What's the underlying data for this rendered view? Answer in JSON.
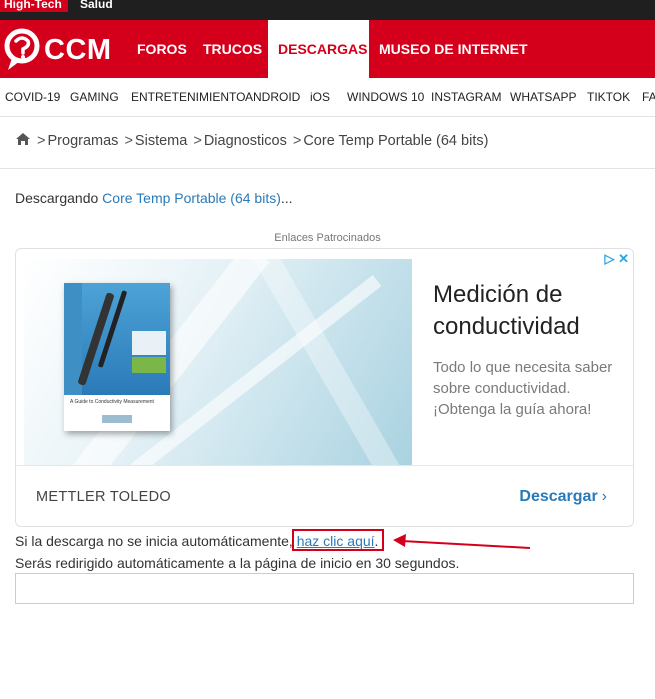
{
  "top_strip": {
    "links": [
      "High-Tech",
      "Salud"
    ]
  },
  "header": {
    "logo_text": "CCM",
    "nav": [
      "FOROS",
      "TRUCOS",
      "DESCARGAS",
      "MUSEO DE INTERNET"
    ],
    "active_nav": "DESCARGAS"
  },
  "subnav": [
    "COVID-19",
    "GAMING",
    "ENTRETENIMIENTO",
    "ANDROID",
    "iOS",
    "WINDOWS 10",
    "INSTAGRAM",
    "WHATSAPP",
    "TIKTOK",
    "FA"
  ],
  "breadcrumb": {
    "home_icon": "home-icon",
    "items": [
      "Programas",
      "Sistema",
      "Diagnosticos",
      "Core Temp Portable (64 bits)"
    ],
    "separator": ">"
  },
  "download": {
    "prefix": "Descargando ",
    "link": "Core Temp Portable (64 bits)",
    "suffix": "..."
  },
  "sponsored_label": "Enlaces Patrocinados",
  "ad": {
    "adchoices": "▷ ✕",
    "title": "Medición de conductividad",
    "body": "Todo lo que necesita saber sobre conductividad. ¡Obtenga la guía ahora!",
    "brand": "METTLER TOLEDO",
    "cta": "Descargar",
    "book_text": "A Guide to Conductivity Measurement"
  },
  "info": {
    "line1_prefix": "Si la descarga no se inicia automáticamente, ",
    "line1_link": "haz clic aquí",
    "line1_suffix": ".",
    "line2": "Serás redirigido automáticamente a la página de inicio en 30 segundos."
  },
  "colors": {
    "brand_red": "#d4001b",
    "link_blue": "#2a7ab8"
  }
}
